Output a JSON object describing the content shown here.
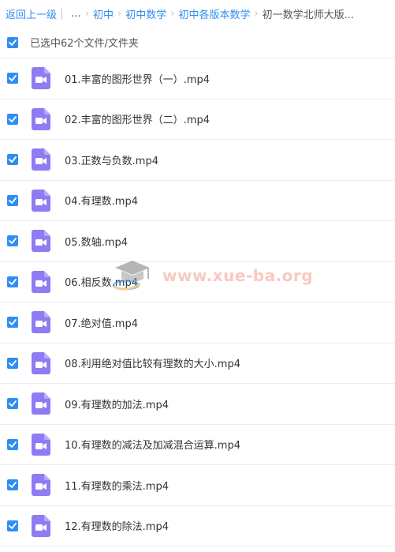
{
  "breadcrumb": {
    "back": "返回上一级",
    "ellipsis": "...",
    "items": [
      "初中",
      "初中数学",
      "初中各版本数学"
    ],
    "current": "初一数学北师大版..."
  },
  "selection": {
    "text": "已选中62个文件/文件夹"
  },
  "files": [
    "01.丰富的图形世界（一）.mp4",
    "02.丰富的图形世界（二）.mp4",
    "03.正数与负数.mp4",
    "04.有理数.mp4",
    "05.数轴.mp4",
    "06.相反数.mp4",
    "07.绝对值.mp4",
    "08.利用绝对值比较有理数的大小.mp4",
    "09.有理数的加法.mp4",
    "10.有理数的减法及加减混合运算.mp4",
    "11.有理数的乘法.mp4",
    "12.有理数的除法.mp4"
  ],
  "watermark": {
    "text": "www.xue-ba.org"
  },
  "colors": {
    "accent": "#2e8ff0",
    "video_icon": "#8d7cf3"
  },
  "icons": {
    "file": "video-file-icon",
    "checkbox": "checkbox-checked-icon",
    "watermark": "graduation-cap-icon"
  }
}
